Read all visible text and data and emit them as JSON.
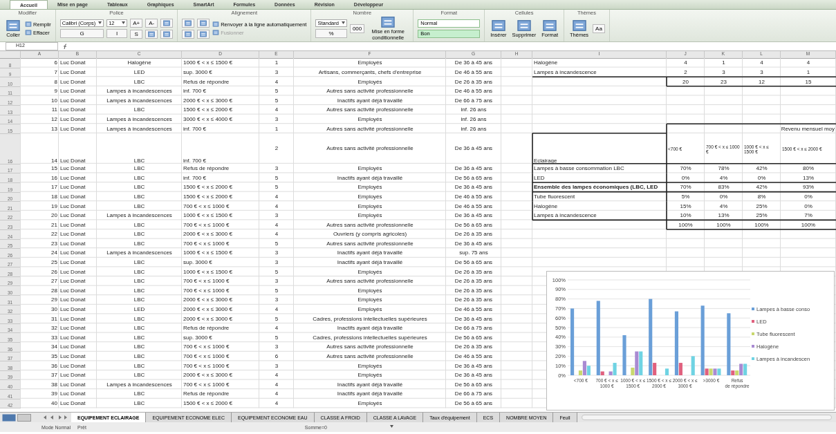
{
  "ribbon_tabs": [
    {
      "label": "Accueil",
      "selected": true
    },
    {
      "label": "Mise en page",
      "selected": false
    },
    {
      "label": "Tableaux",
      "selected": false
    },
    {
      "label": "Graphiques",
      "selected": false
    },
    {
      "label": "SmartArt",
      "selected": false
    },
    {
      "label": "Formules",
      "selected": false
    },
    {
      "label": "Données",
      "selected": false
    },
    {
      "label": "Révision",
      "selected": false
    },
    {
      "label": "Développeur",
      "selected": false
    }
  ],
  "ribbon_groups": [
    {
      "label": "Modifier",
      "columns": [
        [
          {
            "kind": "big",
            "label": "Coller"
          }
        ],
        [
          {
            "kind": "small",
            "label": "Remplir"
          },
          {
            "kind": "small",
            "label": "Effacer"
          }
        ]
      ]
    },
    {
      "label": "Police",
      "columns": [
        [
          {
            "kind": "field",
            "value": "Calibri (Corps)"
          },
          {
            "kind": "letter",
            "label": "G"
          }
        ],
        [
          {
            "kind": "field",
            "value": "12"
          },
          {
            "kind": "letter",
            "label": "I"
          }
        ],
        [
          {
            "kind": "letter",
            "label": "A+"
          },
          {
            "kind": "letter",
            "label": "S"
          }
        ],
        [
          {
            "kind": "letter",
            "label": "A-"
          },
          {
            "kind": "icon"
          }
        ],
        [
          {
            "kind": "icon"
          },
          {
            "kind": "icon"
          }
        ]
      ]
    },
    {
      "label": "Alignement",
      "columns": [
        [
          {
            "kind": "icon"
          },
          {
            "kind": "icon"
          }
        ],
        [
          {
            "kind": "icon"
          },
          {
            "kind": "icon"
          }
        ],
        [
          {
            "kind": "small",
            "label": "Renvoyer à la ligne automatiquement",
            "disabled": false
          },
          {
            "kind": "small",
            "label": "Fusionner",
            "disabled": true
          }
        ]
      ]
    },
    {
      "label": "Nombre",
      "columns": [
        [
          {
            "kind": "field",
            "value": "Standard"
          },
          {
            "kind": "letter",
            "label": "%"
          }
        ],
        [
          {
            "kind": "letter",
            "label": "000"
          }
        ],
        [
          {
            "kind": "big",
            "label": "Mise en forme conditionnelle"
          }
        ]
      ]
    },
    {
      "label": "Format",
      "columns": [
        [
          {
            "kind": "style",
            "label": "Normal",
            "color": "#ffffff"
          },
          {
            "kind": "style",
            "label": "Bon",
            "color": "#c6efce"
          }
        ]
      ]
    },
    {
      "label": "Cellules",
      "columns": [
        [
          {
            "kind": "big",
            "label": "Insérer"
          }
        ],
        [
          {
            "kind": "big",
            "label": "Supprimer"
          }
        ],
        [
          {
            "kind": "big",
            "label": "Format"
          }
        ]
      ]
    },
    {
      "label": "Thèmes",
      "columns": [
        [
          {
            "kind": "big",
            "label": "Thèmes"
          }
        ],
        [
          {
            "kind": "letter",
            "label": "Aa"
          }
        ]
      ]
    }
  ],
  "name_box": "H12",
  "columns": [
    "A",
    "B",
    "C",
    "D",
    "E",
    "F",
    "G",
    "H",
    "I",
    "J",
    "K",
    "L",
    "M"
  ],
  "rows": [
    {
      "number": "8",
      "cells": {
        "A": "6",
        "B": "Luc Donat",
        "C": "Halogène",
        "D": "1000 € < x ≤ 1500 €",
        "E": "1",
        "F": "Employés",
        "G": "De 36 à 45 ans",
        "I": "Halogène",
        "J": "4",
        "K": "1",
        "L": "4",
        "M": "4"
      }
    },
    {
      "number": "9",
      "cells": {
        "A": "7",
        "B": "Luc Donat",
        "C": "LED",
        "D": "sup. 3000 €",
        "E": "3",
        "F": "Artisans, commerçants, chefs d'entreprise",
        "G": "De 46 à 55 ans",
        "I": "Lampes à incandescence",
        "J": "2",
        "K": "3",
        "L": "3",
        "M": "1"
      }
    },
    {
      "number": "10",
      "cells": {
        "A": "8",
        "B": "Luc Donat",
        "C": "LBC",
        "D": "Refus de répondre",
        "E": "4",
        "F": "Employés",
        "G": "De 26 à 35 ans",
        "J": "20",
        "K": "23",
        "L": "12",
        "M": "15"
      }
    },
    {
      "number": "11",
      "cells": {
        "A": "9",
        "B": "Luc Donat",
        "C": "Lampes à incandescences",
        "D": "inf. 700 €",
        "E": "5",
        "F": "Autres sans activité professionnelle",
        "G": "De 46 à 55 ans"
      }
    },
    {
      "number": "12",
      "cells": {
        "A": "10",
        "B": "Luc Donat",
        "C": "Lampes à incandescences",
        "D": "2000 € < x ≤ 3000 €",
        "E": "5",
        "F": "Inactifs ayant déjà travaillé",
        "G": "De 66 à 75 ans"
      }
    },
    {
      "number": "13",
      "cells": {
        "A": "11",
        "B": "Luc Donat",
        "C": "LBC",
        "D": "1500 € < x ≤ 2000 €",
        "E": "4",
        "F": "Autres sans activité professionnelle",
        "G": "inf. 26 ans"
      }
    },
    {
      "number": "14",
      "cells": {
        "A": "12",
        "B": "Luc Donat",
        "C": "Lampes à incandescences",
        "D": "3000 € < x ≤ 4000 €",
        "E": "3",
        "F": "Employés",
        "G": "inf. 26 ans"
      }
    },
    {
      "number": "15",
      "cells": {
        "A": "13",
        "B": "Luc Donat",
        "C": "Lampes à incandescences",
        "D": "inf. 700 €",
        "E": "1",
        "F": "Autres sans activité professionnelle",
        "G": "inf. 26 ans",
        "M": "Revenu mensuel moy"
      }
    },
    {
      "number": "16",
      "tall": true,
      "cells": {
        "A": "14",
        "B": "Luc Donat",
        "C": "LBC",
        "D": "inf. 700 €",
        "E": "2",
        "F": "Autres sans activité professionnelle",
        "G": "De 36 à 45 ans",
        "I": "Eclairage",
        "J": "<700 €",
        "K": "700 € < x ≤ 1000 €",
        "L": "1000 € < x ≤ 1500 €",
        "M": "1500 € < x ≤ 2000 €"
      }
    },
    {
      "number": "17",
      "cells": {
        "A": "15",
        "B": "Luc Donat",
        "C": "LBC",
        "D": "Refus de répondre",
        "E": "3",
        "F": "Employés",
        "G": "De 36 à 45 ans",
        "I": "Lampes à basse consommation LBC",
        "J": "70%",
        "K": "78%",
        "L": "42%",
        "M": "80%"
      }
    },
    {
      "number": "18",
      "cells": {
        "A": "16",
        "B": "Luc Donat",
        "C": "LBC",
        "D": "inf. 700 €",
        "E": "5",
        "F": "Inactifs ayant déjà travaillé",
        "G": "De 56 à 65 ans",
        "I": "LED",
        "J": "0%",
        "K": "4%",
        "L": "0%",
        "M": "13%"
      }
    },
    {
      "number": "19",
      "label_bold": true,
      "cells": {
        "A": "17",
        "B": "Luc Donat",
        "C": "LBC",
        "D": "1500 € < x ≤ 2000 €",
        "E": "5",
        "F": "Employés",
        "G": "De 36 à 45 ans",
        "I": "Ensemble des lampes économiques (LBC, LED",
        "J": "70%",
        "K": "83%",
        "L": "42%",
        "M": "93%"
      }
    },
    {
      "number": "20",
      "cells": {
        "A": "18",
        "B": "Luc Donat",
        "C": "LBC",
        "D": "1500 € < x ≤ 2000 €",
        "E": "4",
        "F": "Employés",
        "G": "De 46 à 55 ans",
        "I": "Tube fluorescent",
        "J": "5%",
        "K": "0%",
        "L": "8%",
        "M": "0%"
      }
    },
    {
      "number": "21",
      "cells": {
        "A": "19",
        "B": "Luc Donat",
        "C": "LBC",
        "D": "700 € < x ≤ 1000 €",
        "E": "4",
        "F": "Employés",
        "G": "De 46 à 55 ans",
        "I": "Halogène",
        "J": "15%",
        "K": "4%",
        "L": "25%",
        "M": "0%"
      }
    },
    {
      "number": "22",
      "cells": {
        "A": "20",
        "B": "Luc Donat",
        "C": "Lampes à incandescences",
        "D": "1000 € < x ≤ 1500 €",
        "E": "3",
        "F": "Employés",
        "G": "De 36 à 45 ans",
        "I": "Lampes à incandescence",
        "J": "10%",
        "K": "13%",
        "L": "25%",
        "M": "7%"
      }
    },
    {
      "number": "23",
      "cells": {
        "A": "21",
        "B": "Luc Donat",
        "C": "LBC",
        "D": "700 € < x ≤ 1000 €",
        "E": "4",
        "F": "Autres sans activité professionnelle",
        "G": "De 56 à 65 ans",
        "J": "100%",
        "K": "100%",
        "L": "100%",
        "M": "100%"
      }
    },
    {
      "number": "24",
      "cells": {
        "A": "22",
        "B": "Luc Donat",
        "C": "LBC",
        "D": "2000 € < x ≤ 3000 €",
        "E": "4",
        "F": "Ouvriers (y compris agricoles)",
        "G": "De 26 à 35 ans"
      }
    },
    {
      "number": "25",
      "cells": {
        "A": "23",
        "B": "Luc Donat",
        "C": "LBC",
        "D": "700 € < x ≤ 1000 €",
        "E": "5",
        "F": "Autres sans activité professionnelle",
        "G": "De 36 à 45 ans"
      }
    },
    {
      "number": "26",
      "cells": {
        "A": "24",
        "B": "Luc Donat",
        "C": "Lampes à incandescences",
        "D": "1000 € < x ≤ 1500 €",
        "E": "3",
        "F": "Inactifs ayant déjà travaillé",
        "G": "sup. 75 ans"
      }
    },
    {
      "number": "27",
      "cells": {
        "A": "25",
        "B": "Luc Donat",
        "C": "LBC",
        "D": "sup. 3000 €",
        "E": "3",
        "F": "Inactifs ayant déjà travaillé",
        "G": "De 56 à 65 ans"
      }
    },
    {
      "number": "28",
      "cells": {
        "A": "26",
        "B": "Luc Donat",
        "C": "LBC",
        "D": "1000 € < x ≤ 1500 €",
        "E": "5",
        "F": "Employés",
        "G": "De 26 à 35 ans"
      }
    },
    {
      "number": "29",
      "cells": {
        "A": "27",
        "B": "Luc Donat",
        "C": "LBC",
        "D": "700 € < x ≤ 1000 €",
        "E": "3",
        "F": "Autres sans activité professionnelle",
        "G": "De 26 à 35 ans"
      }
    },
    {
      "number": "30",
      "cells": {
        "A": "28",
        "B": "Luc Donat",
        "C": "LBC",
        "D": "700 € < x ≤ 1000 €",
        "E": "5",
        "F": "Employés",
        "G": "De 26 à 35 ans"
      }
    },
    {
      "number": "31",
      "cells": {
        "A": "29",
        "B": "Luc Donat",
        "C": "LBC",
        "D": "2000 € < x ≤ 3000 €",
        "E": "3",
        "F": "Employés",
        "G": "De 26 à 35 ans"
      }
    },
    {
      "number": "32",
      "cells": {
        "A": "30",
        "B": "Luc Donat",
        "C": "LED",
        "D": "2000 € < x ≤ 3000 €",
        "E": "4",
        "F": "Employés",
        "G": "De 46 à 55 ans"
      }
    },
    {
      "number": "33",
      "cells": {
        "A": "31",
        "B": "Luc Donat",
        "C": "LBC",
        "D": "2000 € < x ≤ 3000 €",
        "E": "5",
        "F": "Cadres, professions intellectuelles supérieures",
        "G": "De 36 à 45 ans"
      }
    },
    {
      "number": "34",
      "cells": {
        "A": "32",
        "B": "Luc Donat",
        "C": "LBC",
        "D": "Refus de répondre",
        "E": "4",
        "F": "Inactifs ayant déjà travaillé",
        "G": "De 66 à 75 ans"
      }
    },
    {
      "number": "35",
      "cells": {
        "A": "33",
        "B": "Luc Donat",
        "C": "LBC",
        "D": "sup. 3000 €",
        "E": "5",
        "F": "Cadres, professions intellectuelles supérieures",
        "G": "De 56 à 65 ans"
      }
    },
    {
      "number": "36",
      "cells": {
        "A": "34",
        "B": "Luc Donat",
        "C": "LBC",
        "D": "700 € < x ≤ 1000 €",
        "E": "3",
        "F": "Autres sans activité professionnelle",
        "G": "De 26 à 35 ans"
      }
    },
    {
      "number": "37",
      "cells": {
        "A": "35",
        "B": "Luc Donat",
        "C": "LBC",
        "D": "700 € < x ≤ 1000 €",
        "E": "6",
        "F": "Autres sans activité professionnelle",
        "G": "De 46 à 55 ans"
      }
    },
    {
      "number": "38",
      "cells": {
        "A": "36",
        "B": "Luc Donat",
        "C": "LBC",
        "D": "700 € < x ≤ 1000 €",
        "E": "3",
        "F": "Employés",
        "G": "De 36 à 45 ans"
      }
    },
    {
      "number": "39",
      "cells": {
        "A": "37",
        "B": "Luc Donat",
        "C": "LBC",
        "D": "2000 € < x ≤ 3000 €",
        "E": "4",
        "F": "Employés",
        "G": "De 36 à 45 ans"
      }
    },
    {
      "number": "40",
      "cells": {
        "A": "38",
        "B": "Luc Donat",
        "C": "Lampes à incandescences",
        "D": "700 € < x ≤ 1000 €",
        "E": "4",
        "F": "Inactifs ayant déjà travaillé",
        "G": "De 56 à 65 ans"
      }
    },
    {
      "number": "41",
      "cells": {
        "A": "39",
        "B": "Luc Donat",
        "C": "LBC",
        "D": "Refus de répondre",
        "E": "4",
        "F": "Inactifs ayant déjà travaillé",
        "G": "De 66 à 75 ans"
      }
    },
    {
      "number": "42",
      "cells": {
        "A": "40",
        "B": "Luc Donat",
        "C": "LBC",
        "D": "1500 € < x ≤ 2000 €",
        "E": "4",
        "F": "Employés",
        "G": "De 56 à 65 ans"
      }
    }
  ],
  "chart_data": {
    "type": "bar",
    "categories": [
      "<700 €",
      "700 € < x ≤ 1000 €",
      "1000 € < x ≤ 1500 €",
      "1500 € < x ≤ 2000 €",
      "2000 € < x ≤ 3000 €",
      ">3000 €",
      "Refus de répondre"
    ],
    "series": [
      {
        "name": "Lampes à basse conso",
        "color": "#6a9fd8",
        "values": [
          70,
          78,
          42,
          80,
          67,
          73,
          65
        ]
      },
      {
        "name": "LED",
        "color": "#e0607e",
        "values": [
          0,
          4,
          0,
          13,
          13,
          7,
          5
        ]
      },
      {
        "name": "Tube fluorescent",
        "color": "#c9d86e",
        "values": [
          5,
          0,
          8,
          0,
          0,
          7,
          5
        ]
      },
      {
        "name": "Halogène",
        "color": "#a98ad2",
        "values": [
          15,
          4,
          25,
          0,
          0,
          7,
          12
        ]
      },
      {
        "name": "Lampes à incandescen",
        "color": "#6fd3e3",
        "values": [
          10,
          13,
          25,
          7,
          20,
          7,
          12
        ]
      }
    ],
    "ylim": [
      0,
      100
    ],
    "grid": true,
    "legend": true,
    "yticks": [
      {
        "value": 0,
        "label": "0%"
      },
      {
        "value": 10,
        "label": "10%"
      },
      {
        "value": 20,
        "label": "20%"
      },
      {
        "value": 30,
        "label": "30%"
      },
      {
        "value": 40,
        "label": "40%"
      },
      {
        "value": 50,
        "label": "50%"
      },
      {
        "value": 60,
        "label": "60%"
      },
      {
        "value": 70,
        "label": "70%"
      },
      {
        "value": 80,
        "label": "80%"
      },
      {
        "value": 90,
        "label": "90%"
      },
      {
        "value": 100,
        "label": "100%"
      }
    ]
  },
  "sheet_tabs": [
    {
      "label": "EQUIPEMENT ECLAIRAGE",
      "selected": true
    },
    {
      "label": "EQUIPEMENT ECONOME ELEC",
      "selected": false
    },
    {
      "label": "EQUIPEMENT ECONOME EAU",
      "selected": false
    },
    {
      "label": "CLASSE A FROID",
      "selected": false
    },
    {
      "label": "CLASSE A LAVAGE",
      "selected": false
    },
    {
      "label": "Taux d'équipement",
      "selected": false
    },
    {
      "label": "ECS",
      "selected": false
    },
    {
      "label": "NOMBRE MOYEN",
      "selected": false
    },
    {
      "label": "Feuil",
      "selected": false
    }
  ],
  "status_bar": {
    "mode": "Mode Normal",
    "state": "Prêt",
    "sum": "Somme=0"
  }
}
